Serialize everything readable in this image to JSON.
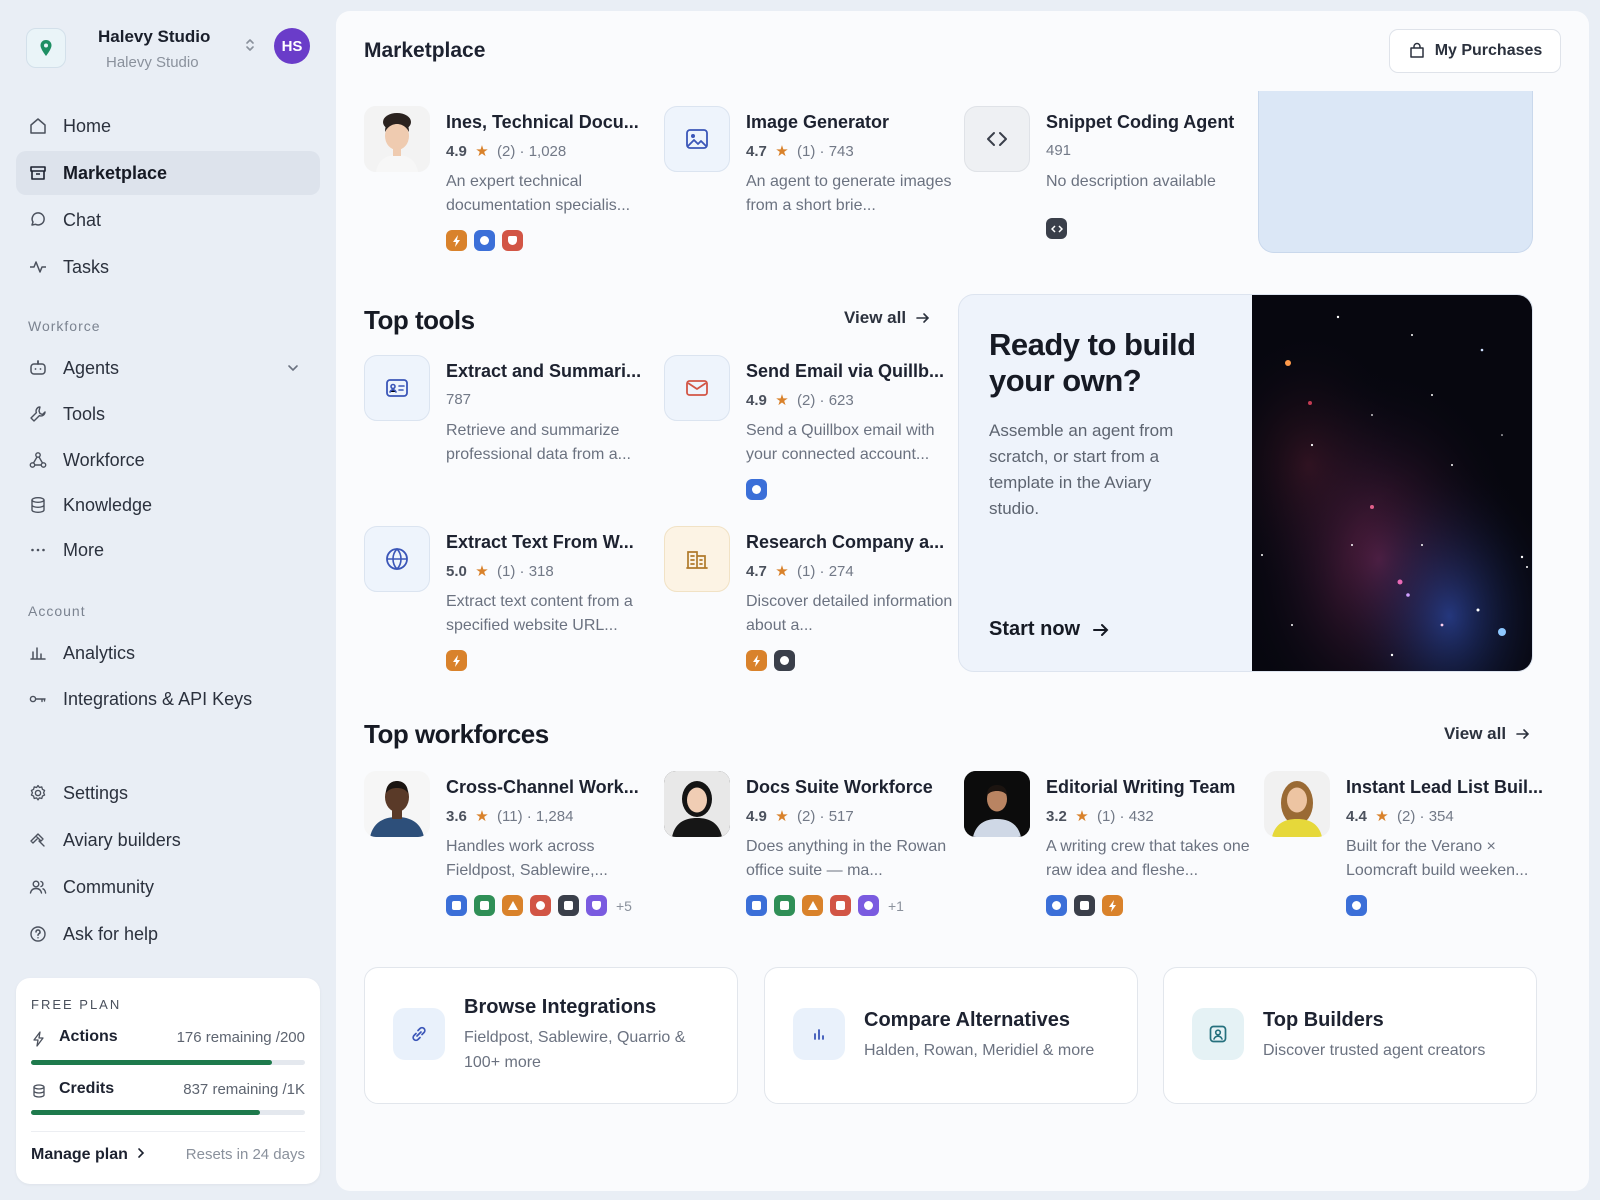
{
  "workspace": {
    "name": "Halevy Studio",
    "subtitle": "Halevy Studio",
    "avatar_initials": "HS"
  },
  "nav": {
    "primary": [
      {
        "label": "Home",
        "icon": "home-icon"
      },
      {
        "label": "Marketplace",
        "icon": "store-icon",
        "active": true
      },
      {
        "label": "Chat",
        "icon": "chat-icon"
      },
      {
        "label": "Tasks",
        "icon": "activity-icon"
      }
    ],
    "workforce_section": "Workforce",
    "workforce": [
      {
        "label": "Agents",
        "icon": "bot-icon"
      },
      {
        "label": "Tools",
        "icon": "wrench-icon"
      },
      {
        "label": "Workforce",
        "icon": "network-icon"
      },
      {
        "label": "Knowledge",
        "icon": "database-icon"
      },
      {
        "label": "More",
        "icon": "ellipsis-icon"
      }
    ],
    "account_section": "Account",
    "account": [
      {
        "label": "Analytics",
        "icon": "bar-chart-icon"
      },
      {
        "label": "Integrations & API Keys",
        "icon": "key-icon"
      }
    ],
    "bottom": [
      {
        "label": "Settings",
        "icon": "gear-icon"
      },
      {
        "label": "Aviary builders",
        "icon": "hammer-icon"
      },
      {
        "label": "Community",
        "icon": "users-icon"
      },
      {
        "label": "Ask for help",
        "icon": "help-icon"
      }
    ]
  },
  "plan": {
    "label": "FREE PLAN",
    "actions": {
      "label": "Actions",
      "remaining": "176 remaining /200",
      "fraction": 0.88
    },
    "credits": {
      "label": "Credits",
      "remaining": "837 remaining /1K",
      "fraction": 0.837
    },
    "manage": "Manage plan",
    "resets": "Resets in 24 days"
  },
  "header": {
    "title": "Marketplace",
    "purchases_button": "My Purchases"
  },
  "agents": [
    {
      "title": "Ines, Technical Docu...",
      "rating": "4.9",
      "reviews": "(2)",
      "count": "1,028",
      "desc": "An expert technical documentation specialis..."
    },
    {
      "title": "Image Generator",
      "rating": "4.7",
      "reviews": "(1)",
      "count": "743",
      "desc": "An agent to generate images from a short brie..."
    },
    {
      "title": "Snippet Coding Agent",
      "count": "491",
      "desc": "No description available"
    }
  ],
  "top_tools": {
    "heading": "Top tools",
    "view_all": "View all",
    "items": [
      {
        "title": "Extract and Summari...",
        "count": "787",
        "desc": "Retrieve and summarize professional data from a..."
      },
      {
        "title": "Send Email via Quillb...",
        "rating": "4.9",
        "reviews": "(2)",
        "count": "623",
        "desc": "Send a Quillbox email with your connected account..."
      },
      {
        "title": "Extract Text From W...",
        "rating": "5.0",
        "reviews": "(1)",
        "count": "318",
        "desc": "Extract text content from a specified website URL..."
      },
      {
        "title": "Research Company a...",
        "rating": "4.7",
        "reviews": "(1)",
        "count": "274",
        "desc": "Discover detailed information about a..."
      }
    ]
  },
  "promo": {
    "title": "Ready to build your own?",
    "body": "Assemble an agent from scratch, or start from a template in the Aviary studio.",
    "cta": "Start now"
  },
  "top_workforces": {
    "heading": "Top workforces",
    "view_all": "View all",
    "items": [
      {
        "title": "Cross-Channel Work...",
        "rating": "3.6",
        "reviews": "(11)",
        "count": "1,284",
        "desc": "Handles work across Fieldpost, Sablewire,...",
        "more": "+5"
      },
      {
        "title": "Docs Suite Workforce",
        "rating": "4.9",
        "reviews": "(2)",
        "count": "517",
        "desc": "Does anything in the Rowan office suite — ma...",
        "more": "+1"
      },
      {
        "title": "Editorial Writing Team",
        "rating": "3.2",
        "reviews": "(1)",
        "count": "432",
        "desc": "A writing crew that takes one raw idea and fleshe..."
      },
      {
        "title": "Instant Lead List Buil...",
        "rating": "4.4",
        "reviews": "(2)",
        "count": "354",
        "desc": "Built for the Verano × Loomcraft build weeken..."
      }
    ]
  },
  "bottom_cards": [
    {
      "title": "Browse Integrations",
      "subtitle": "Fieldpost, Sablewire, Quarrio & 100+ more",
      "icon": "link-icon"
    },
    {
      "title": "Compare Alternatives",
      "subtitle": "Halden, Rowan, Meridiel & more",
      "icon": "bar-chart-icon"
    },
    {
      "title": "Top Builders",
      "subtitle": "Discover trusted agent creators",
      "icon": "user-badge-icon"
    }
  ],
  "badge_colors": {
    "orange": "#d9822b",
    "blue": "#3b6fd8",
    "red": "#d25545",
    "green": "#2f8f57",
    "dark": "#3a3f4a",
    "purple": "#7a5be0"
  }
}
